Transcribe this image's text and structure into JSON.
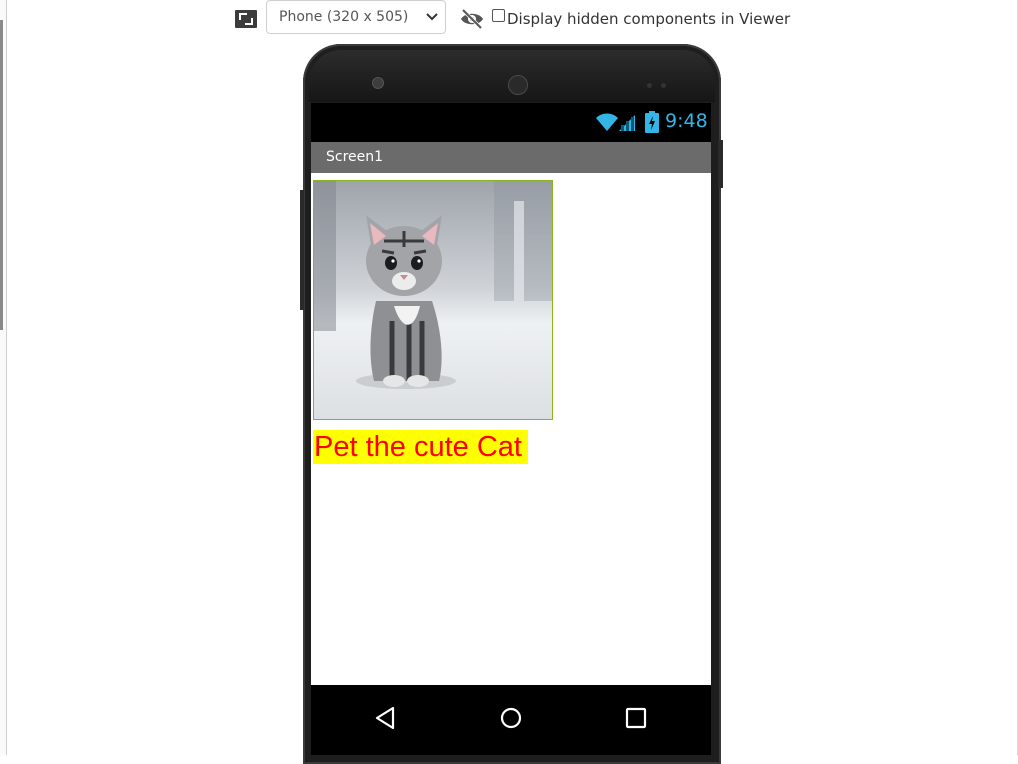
{
  "toolbar": {
    "device_select": {
      "selected": "Phone (320 x 505)"
    },
    "hidden_components_label": "Display hidden components in Viewer",
    "hidden_components_checked": false,
    "icons": {
      "resize": "resize-icon",
      "visibility": "eye-off-icon"
    }
  },
  "phone": {
    "status_bar": {
      "time": "9:48",
      "accent": "#33b5e5"
    },
    "title": "Screen1",
    "image": {
      "description": "cat-image"
    },
    "label": {
      "text": "Pet the cute Cat",
      "text_color": "#ff0000",
      "background": "#ffff00"
    },
    "nav": {
      "icons": [
        "back-icon",
        "home-icon",
        "recent-apps-icon"
      ]
    }
  }
}
